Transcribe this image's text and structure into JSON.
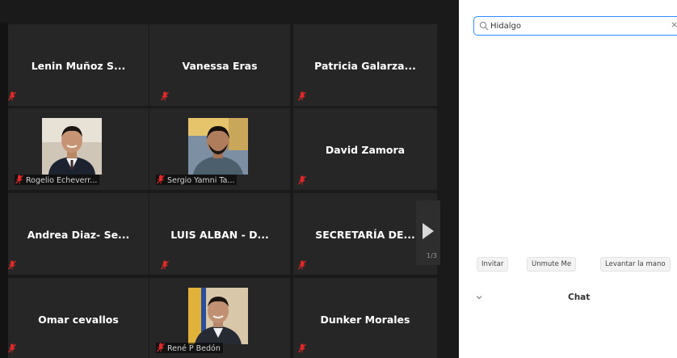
{
  "gallery": {
    "tiles": [
      {
        "name": "Lenin Muñoz  S...",
        "mode": "text"
      },
      {
        "name": "Vanessa Eras",
        "mode": "text"
      },
      {
        "name": "Patricia  Galarza...",
        "mode": "text"
      },
      {
        "name": "Rogelio Echeverr...",
        "mode": "video"
      },
      {
        "name": "Sergio Yamni Ta...",
        "mode": "video"
      },
      {
        "name": "David Zamora",
        "mode": "text"
      },
      {
        "name": "Andrea Diaz- Se...",
        "mode": "text"
      },
      {
        "name": "LUIS ALBAN - D...",
        "mode": "text"
      },
      {
        "name": "SECRETARÍA DE...",
        "mode": "text"
      },
      {
        "name": "Omar cevallos",
        "mode": "text"
      },
      {
        "name": "René P Bedón",
        "mode": "video"
      },
      {
        "name": "Dunker Morales",
        "mode": "text"
      }
    ],
    "page_indicator": "1/3",
    "muted_icon": "muted-mic-icon",
    "colors": {
      "background": "#1a1a1a",
      "tile": "#262626",
      "muted": "#e02828"
    }
  },
  "panel": {
    "search": {
      "value": "Hidalgo",
      "icon": "search-icon"
    },
    "buttons": {
      "invite": "Invitar",
      "unmute": "Unmute Me",
      "raise_hand": "Levantar la mano"
    },
    "chat": {
      "title": "Chat",
      "icon": "chevron-down-icon"
    },
    "colors": {
      "search_border": "#2d8cff"
    }
  }
}
